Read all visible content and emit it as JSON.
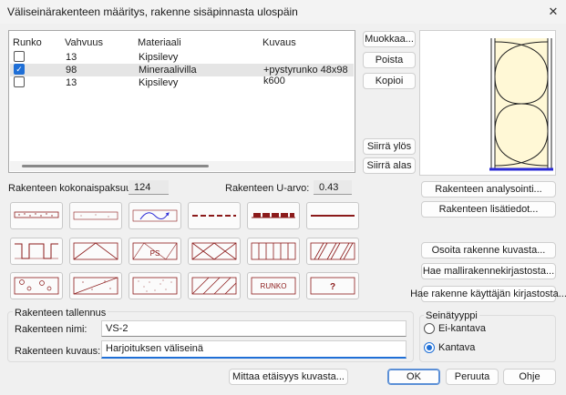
{
  "window": {
    "title": "Väliseinärakenteen määritys, rakenne sisäpinnasta ulospäin"
  },
  "table": {
    "headers": [
      "Runko",
      "Vahvuus",
      "Materiaali",
      "Kuvaus"
    ],
    "rows": [
      {
        "checked": false,
        "vahvuus": "13",
        "materiaali": "Kipsilevy",
        "kuvaus": ""
      },
      {
        "checked": true,
        "vahvuus": "98",
        "materiaali": "Mineraalivilla",
        "kuvaus": "+pystyrunko 48x98 k600"
      },
      {
        "checked": false,
        "vahvuus": "13",
        "materiaali": "Kipsilevy",
        "kuvaus": ""
      }
    ]
  },
  "side_buttons": {
    "edit": "Muokkaa...",
    "delete": "Poista",
    "copy": "Kopioi",
    "move_up": "Siirrä ylös",
    "move_down": "Siirrä alas"
  },
  "summary": {
    "thickness_label": "Rakenteen kokonaispaksuus:",
    "thickness_value": "124",
    "u_label": "Rakenteen U-arvo:",
    "u_value": "0.43"
  },
  "tiles": {
    "ps_label": "PS",
    "runko_label": "RUNKO",
    "question_label": "?"
  },
  "right_buttons": {
    "analysis": "Rakenteen analysointi...",
    "details": "Rakenteen lisätiedot...",
    "pick_from_drawing": "Osoita rakenne kuvasta...",
    "from_model_library": "Hae mallirakennekirjastosta...",
    "from_user_library": "Hae rakenne käyttäjän kirjastosta..."
  },
  "save_group": {
    "title": "Rakenteen tallennus",
    "name_label": "Rakenteen nimi:",
    "name_value": "VS-2",
    "desc_label": "Rakenteen kuvaus:",
    "desc_value": "Harjoituksen väliseinä"
  },
  "wall_type": {
    "title": "Seinätyyppi",
    "options": [
      "Ei-kantava",
      "Kantava"
    ],
    "selected": "Kantava"
  },
  "footer": {
    "measure": "Mittaa etäisyys kuvasta...",
    "ok": "OK",
    "cancel": "Peruuta",
    "help": "Ohje"
  },
  "colors": {
    "accent": "#1f6fd6",
    "pattern": "#8b1a1a",
    "preview_fill": "#fff8d6",
    "preview_base": "#2b2bd6"
  }
}
